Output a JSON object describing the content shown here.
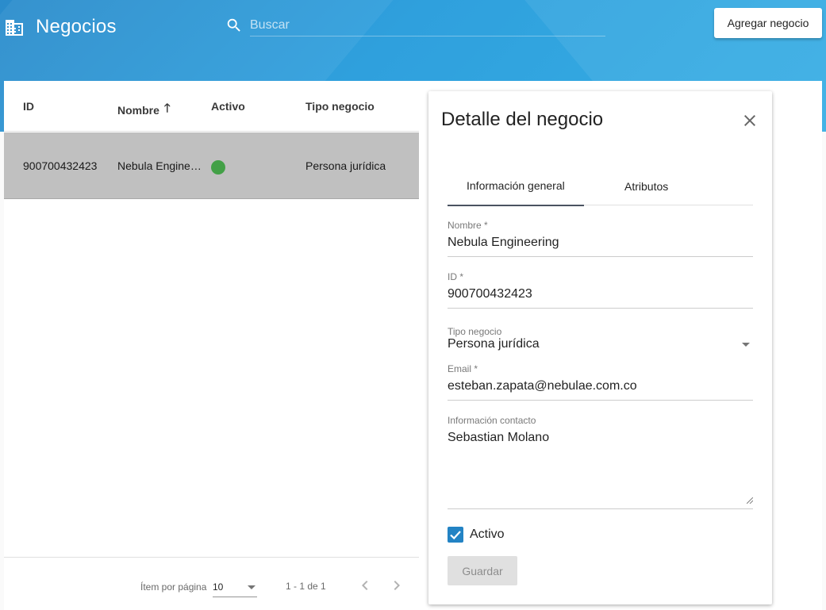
{
  "header": {
    "title": "Negocios",
    "search_placeholder": "Buscar",
    "add_button": "Agregar negocio"
  },
  "table": {
    "columns": [
      "ID",
      "Nombre",
      "Activo",
      "Tipo negocio"
    ],
    "sort_column": "Nombre",
    "rows": [
      {
        "id": "900700432423",
        "nombre": "Nebula Engineeri…",
        "activo": true,
        "tipo": "Persona jurídica"
      }
    ],
    "status_color": "#43a047"
  },
  "paginator": {
    "items_label": "Ítem por página",
    "page_size": "10",
    "range": "1 - 1 de 1"
  },
  "detail": {
    "title": "Detalle del negocio",
    "tabs": [
      "Información general",
      "Atributos"
    ],
    "active_tab": "Información general",
    "fields": {
      "nombre": {
        "label": "Nombre *",
        "value": "Nebula Engineering"
      },
      "id": {
        "label": "ID *",
        "value": "900700432423"
      },
      "tipo": {
        "label": "Tipo negocio",
        "value": "Persona jurídica"
      },
      "email": {
        "label": "Email *",
        "value": "esteban.zapata@nebulae.com.co"
      },
      "contacto": {
        "label": "Información contacto",
        "value": "Sebastian Molano"
      }
    },
    "activo_label": "Activo",
    "activo_checked": true,
    "save_button": "Guardar"
  },
  "colors": {
    "header": "#2fa0dd",
    "checkbox": "#2383c4"
  }
}
